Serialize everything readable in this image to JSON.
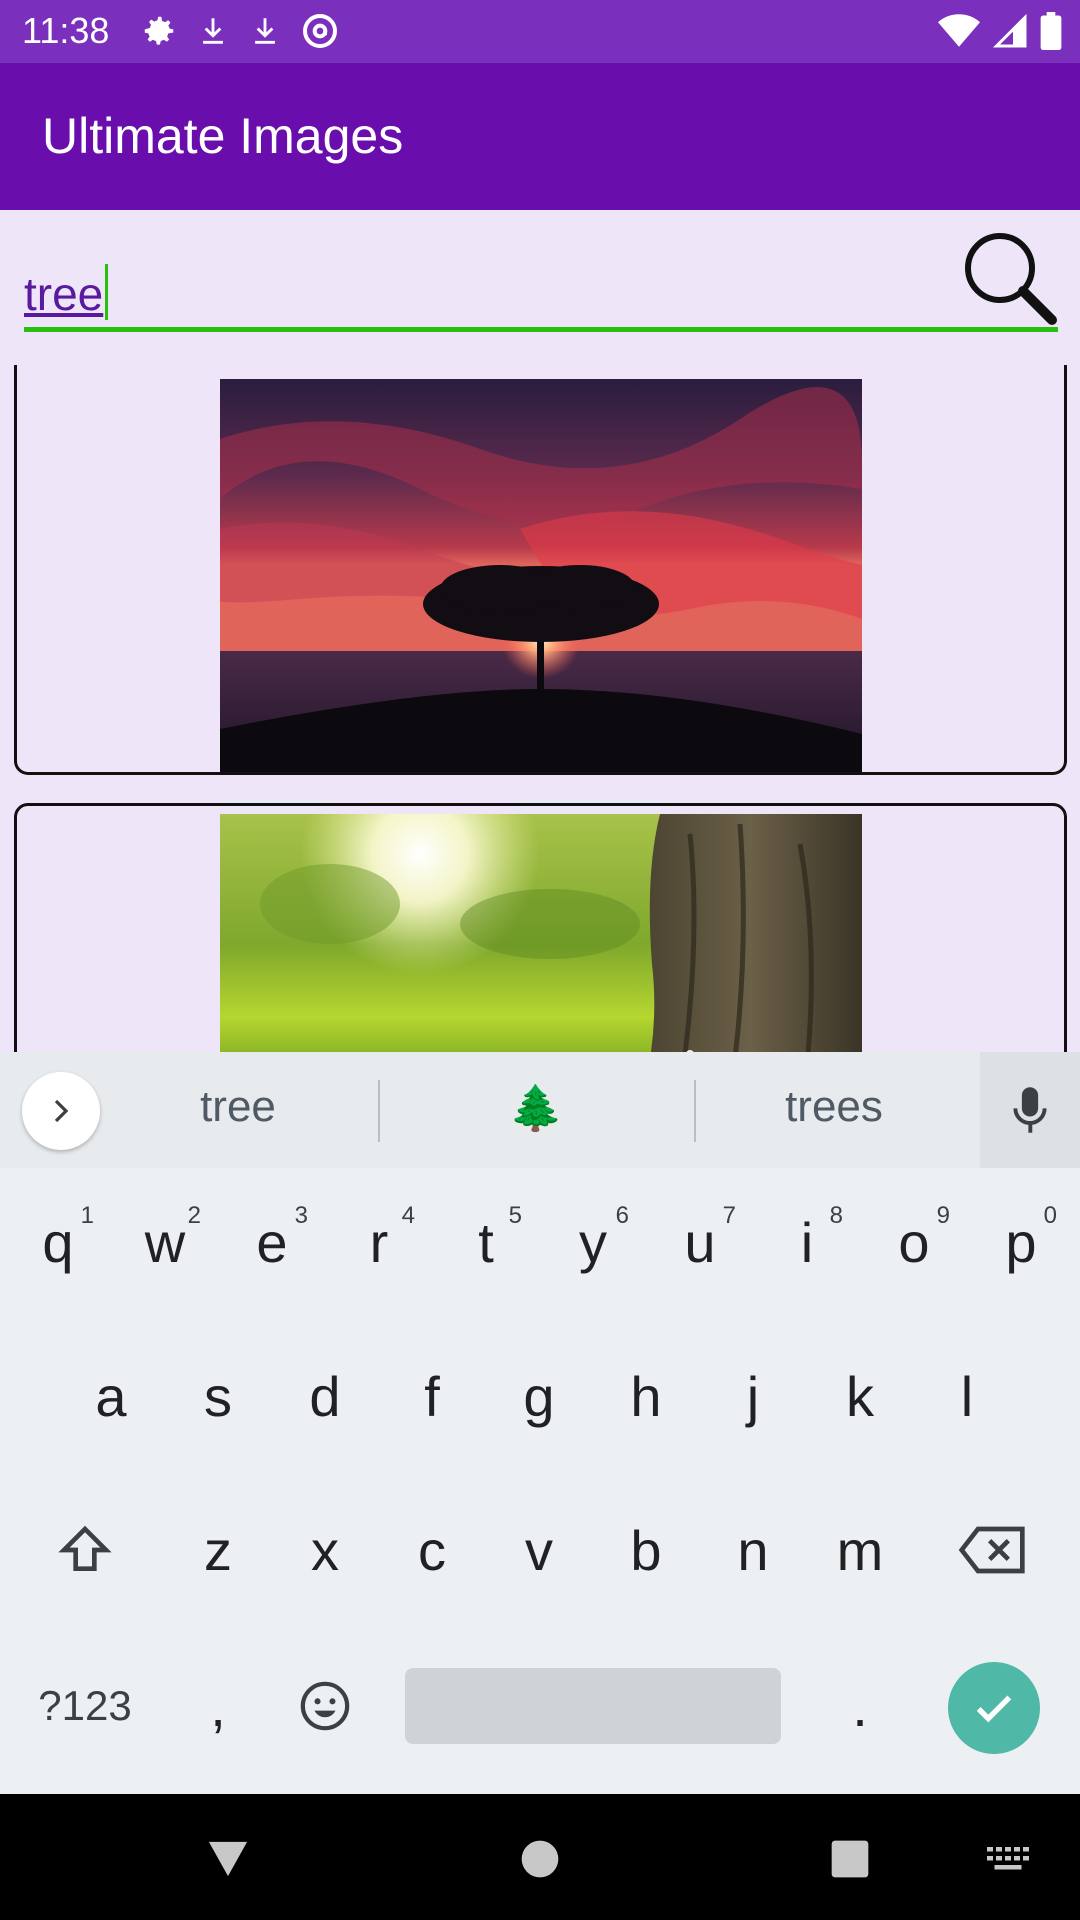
{
  "status_bar": {
    "time": "11:38"
  },
  "app_bar": {
    "title": "Ultimate Images"
  },
  "search": {
    "value": "tree"
  },
  "results": [
    {
      "description": "tree-silhouette-at-sunset"
    },
    {
      "description": "tree-trunk-in-sunny-meadow"
    }
  ],
  "keyboard": {
    "suggestions": [
      "tree",
      "🌲",
      "trees"
    ],
    "row1": [
      {
        "key": "q",
        "hint": "1"
      },
      {
        "key": "w",
        "hint": "2"
      },
      {
        "key": "e",
        "hint": "3"
      },
      {
        "key": "r",
        "hint": "4"
      },
      {
        "key": "t",
        "hint": "5"
      },
      {
        "key": "y",
        "hint": "6"
      },
      {
        "key": "u",
        "hint": "7"
      },
      {
        "key": "i",
        "hint": "8"
      },
      {
        "key": "o",
        "hint": "9"
      },
      {
        "key": "p",
        "hint": "0"
      }
    ],
    "row2": [
      "a",
      "s",
      "d",
      "f",
      "g",
      "h",
      "j",
      "k",
      "l"
    ],
    "row3": [
      "z",
      "x",
      "c",
      "v",
      "b",
      "n",
      "m"
    ],
    "symbols_label": "?123",
    "comma": ",",
    "period": "."
  },
  "colors": {
    "status_bar": "#7b2fbd",
    "app_bar": "#6a0dad",
    "content_bg": "#efe5f9",
    "search_underline": "#27c00f",
    "enter_key": "#4fb8a6"
  }
}
